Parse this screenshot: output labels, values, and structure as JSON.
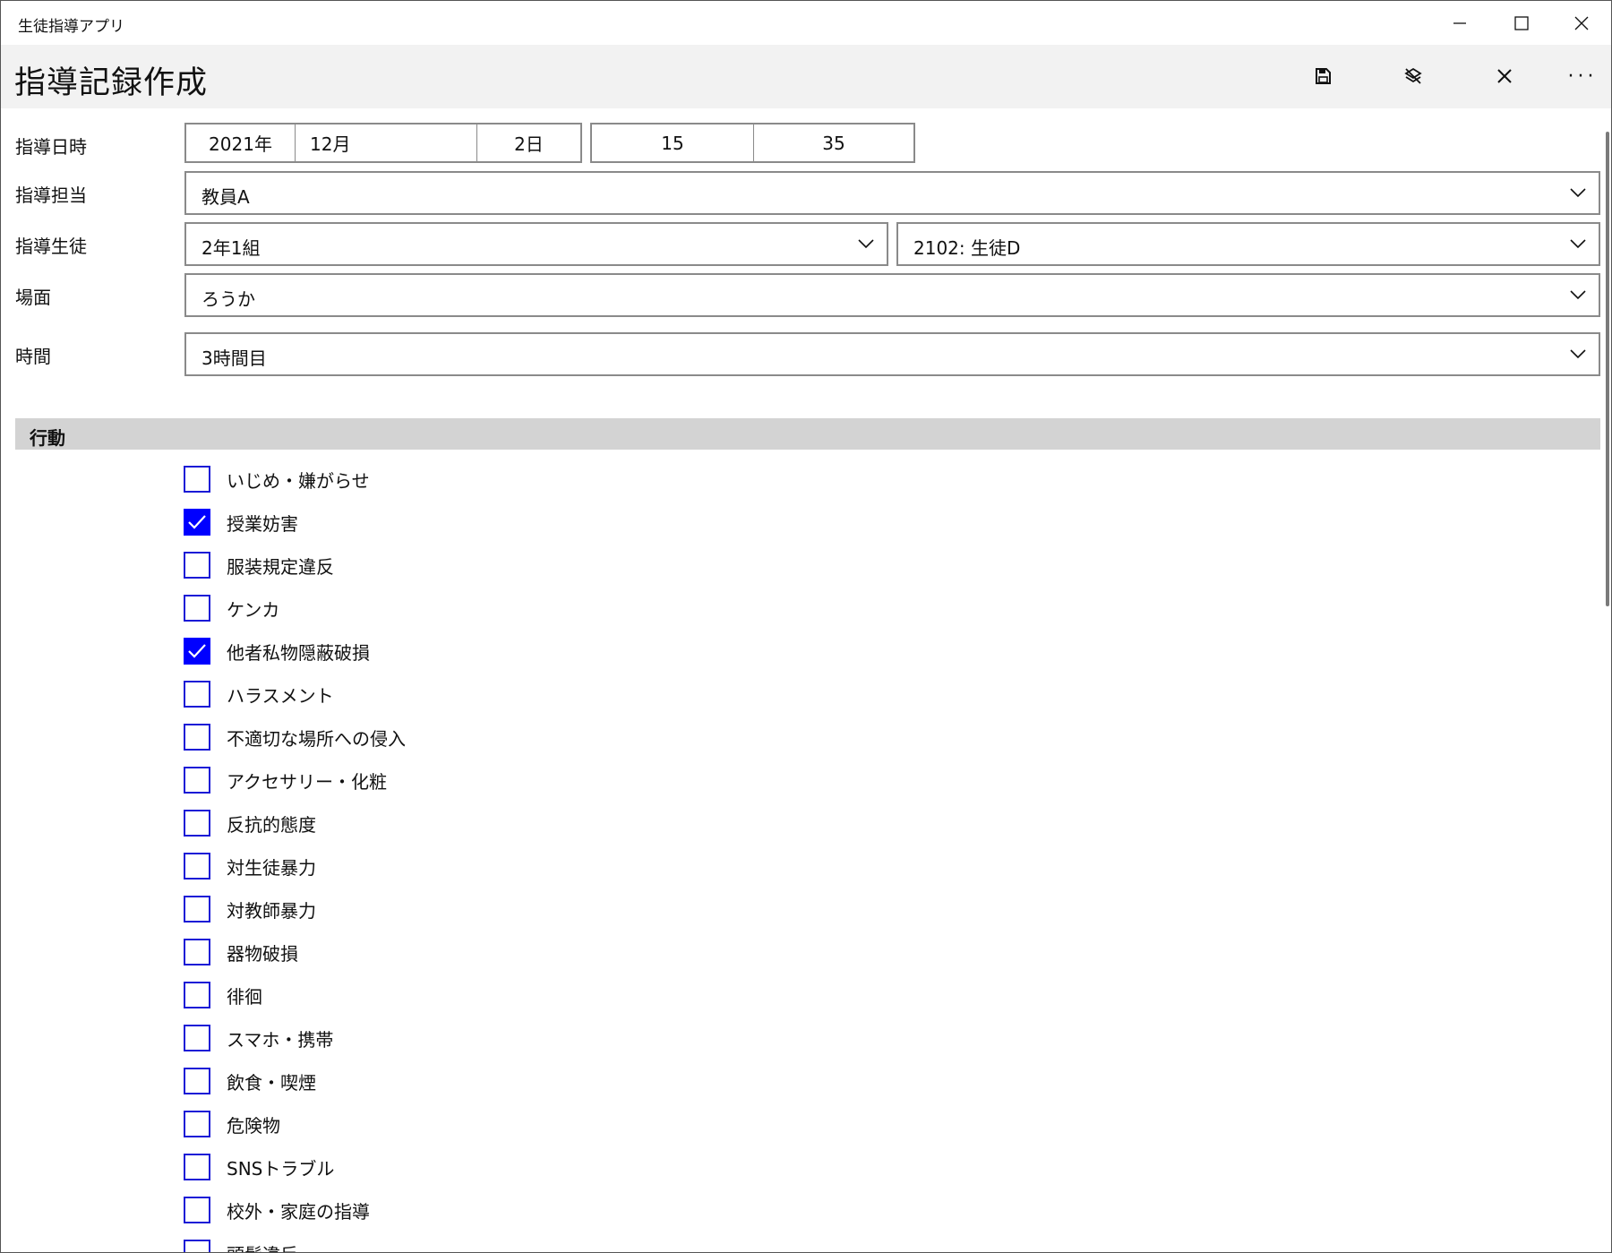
{
  "app_title": "生徒指導アプリ",
  "page_title": "指導記録作成",
  "labels": {
    "datetime": "指導日時",
    "teacher": "指導担当",
    "student": "指導生徒",
    "place": "場面",
    "period": "時間"
  },
  "date": {
    "year": "2021年",
    "month": "12月",
    "day": "2日",
    "hour": "15",
    "minute": "35"
  },
  "teacher_value": "教員A",
  "class_value": "2年1組",
  "student_value": "2102: 生徒D",
  "place_value": "ろうか",
  "period_value": "3時間目",
  "section_title": "行動",
  "behaviors": [
    {
      "label": "いじめ・嫌がらせ",
      "checked": false
    },
    {
      "label": "授業妨害",
      "checked": true
    },
    {
      "label": "服装規定違反",
      "checked": false
    },
    {
      "label": "ケンカ",
      "checked": false
    },
    {
      "label": "他者私物隠蔽破損",
      "checked": true
    },
    {
      "label": "ハラスメント",
      "checked": false
    },
    {
      "label": "不適切な場所への侵入",
      "checked": false
    },
    {
      "label": "アクセサリー・化粧",
      "checked": false
    },
    {
      "label": "反抗的態度",
      "checked": false
    },
    {
      "label": "対生徒暴力",
      "checked": false
    },
    {
      "label": "対教師暴力",
      "checked": false
    },
    {
      "label": "器物破損",
      "checked": false
    },
    {
      "label": "徘徊",
      "checked": false
    },
    {
      "label": "スマホ・携帯",
      "checked": false
    },
    {
      "label": "飲食・喫煙",
      "checked": false
    },
    {
      "label": "危険物",
      "checked": false
    },
    {
      "label": "SNSトラブル",
      "checked": false
    },
    {
      "label": "校外・家庭の指導",
      "checked": false
    },
    {
      "label": "頭髪違反",
      "checked": false
    }
  ],
  "icons": {
    "save": "save-icon",
    "discard": "discard-icon",
    "close": "close-icon",
    "more": "more-icon"
  },
  "colors": {
    "accent": "#0000ff",
    "commandbar": "#f2f2f2",
    "section": "#d3d3d3"
  }
}
